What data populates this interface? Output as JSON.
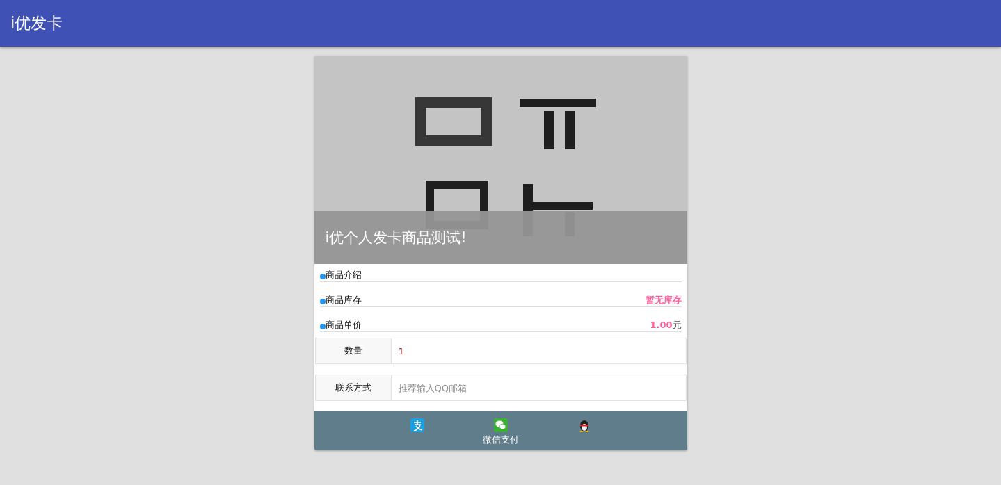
{
  "app_bar": {
    "title": "i优发卡"
  },
  "product": {
    "name": "i优个人发卡商品测试!",
    "info": [
      {
        "label": "商品介绍"
      },
      {
        "label": "商品库存",
        "value": "暂无库存"
      },
      {
        "label": "商品单价",
        "value": "1.00",
        "unit": "元"
      }
    ],
    "fields": [
      {
        "label": "数量",
        "value": "1"
      },
      {
        "label": "联系方式",
        "placeholder": "推荐输入QQ邮箱"
      }
    ]
  },
  "payments": [
    {
      "kind": "alipay"
    },
    {
      "kind": "wechat",
      "label": "微信支付"
    },
    {
      "kind": "qq"
    }
  ]
}
